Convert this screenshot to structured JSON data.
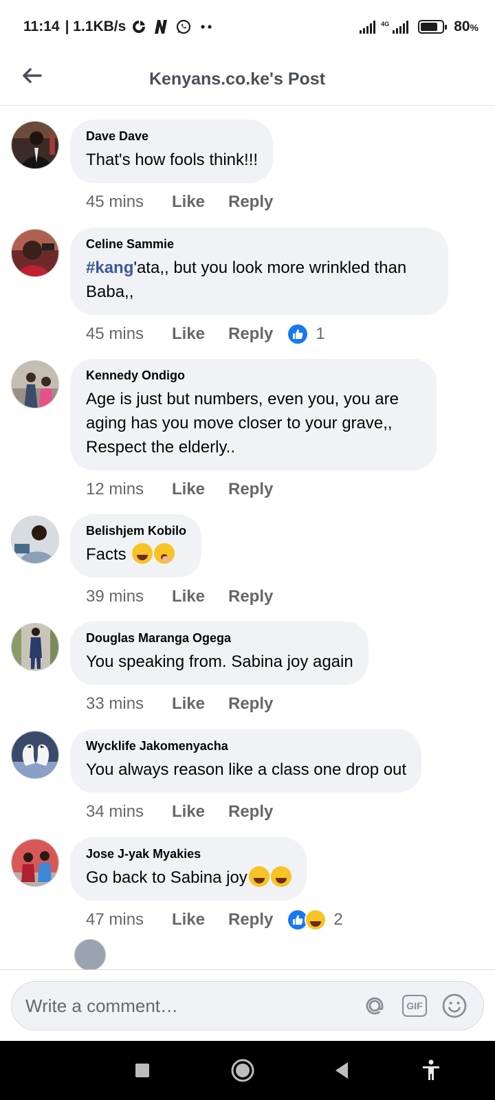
{
  "status_bar": {
    "time": "11:14",
    "speed": "| 1.1KB/s",
    "network_type": "4G",
    "battery_percent": "80",
    "battery_suffix": "%",
    "battery_level": 0.8,
    "icons": [
      "data-saver-icon",
      "netflix-n-icon",
      "whatsapp-icon",
      "more-dots-icon",
      "signal-icon",
      "signal-4g-icon",
      "battery-icon"
    ]
  },
  "header": {
    "title": "Kenyans.co.ke's Post",
    "back_icon": "arrow-left-icon"
  },
  "comments": [
    {
      "name": "Dave Dave",
      "text": "That's how fools think!!!",
      "time": "45 mins",
      "like": "Like",
      "reply": "Reply"
    },
    {
      "name": "Celine Sammie",
      "tag": "#kang",
      "text": "'ata,, but you look more wrinkled than Baba,,",
      "time": "45 mins",
      "like": "Like",
      "reply": "Reply",
      "reaction_count": "1",
      "reactions": [
        "like"
      ]
    },
    {
      "name": "Kennedy Ondigo",
      "text": "Age is just but numbers, even you, you are aging has you move closer to your grave,, Respect the elderly..",
      "time": "12 mins",
      "like": "Like",
      "reply": "Reply"
    },
    {
      "name": "Belishjem Kobilo",
      "text": "Facts",
      "emojis": [
        "face-with-tears-of-joy",
        "face-with-hand-over-mouth"
      ],
      "time": "39 mins",
      "like": "Like",
      "reply": "Reply"
    },
    {
      "name": "Douglas Maranga Ogega",
      "text": "You speaking from. Sabina joy again",
      "time": "33 mins",
      "like": "Like",
      "reply": "Reply"
    },
    {
      "name": "Wycklife Jakomenyacha",
      "text": "You always reason like a class one drop out",
      "time": "34 mins",
      "like": "Like",
      "reply": "Reply"
    },
    {
      "name": "Jose J-yak Myakies",
      "text": "Go back to Sabina joy",
      "emojis": [
        "rolling-on-floor-laughing",
        "rolling-on-floor-laughing"
      ],
      "time": "47 mins",
      "like": "Like",
      "reply": "Reply",
      "reaction_count": "2",
      "reactions": [
        "like",
        "haha"
      ]
    }
  ],
  "composer": {
    "placeholder": "Write a comment…",
    "mention_icon": "at-sign-icon",
    "gif_label": "GIF",
    "emoji_icon": "smiley-icon"
  },
  "colors": {
    "bubble_bg": "#f0f2f5",
    "secondary_text": "#65676b",
    "hashtag": "#385898",
    "like_blue": "#1877f2",
    "nav_bg": "#000000"
  }
}
